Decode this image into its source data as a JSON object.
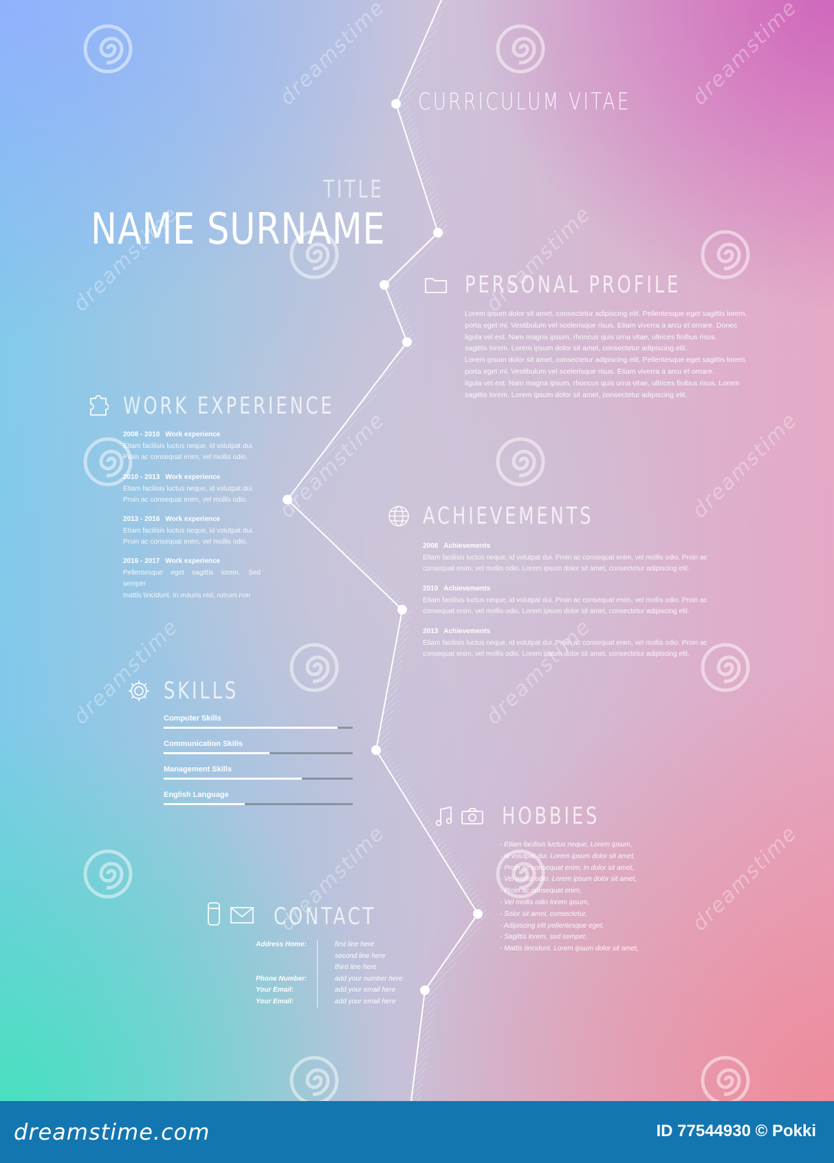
{
  "document": {
    "header": {
      "label": "CURRICULUM VITAE"
    },
    "person": {
      "title": "TITLE",
      "name": "NAME SURNAME"
    },
    "profile": {
      "heading": "PERSONAL PROFILE",
      "icon": "folder-icon",
      "lines": [
        "Lorem ipsum dolor sit amet, consectetur adipiscing elit. Pellentesque eget sagittis lorem.",
        "porta eget mi. Vestibulum vel scelerisque risus. Etiam viverra a arcu et ornare. Donec",
        "ligula vel est. Nam magna ipsum, rhoncus quis urna vitae, ultrices finibus risus.",
        "sagittis lorem. Lorem ipsum dolor sit amet, consectetur adipiscing elit.",
        "Lorem ipsum dolor sit amet, consectetur adipiscing elit. Pellentesque eget sagittis lorem.",
        "porta eget mi. Vestibulum vel scelerisque risus. Etiam viverra a arcu et ornare.",
        "ligula vel est. Nam magna ipsum, rhoncus quis urna vitae, ultrices finibus risus. Lorem",
        "sagittis lorem. Lorem ipsum dolor sit amet, consectetur adipiscing elit."
      ]
    },
    "work": {
      "heading": "WORK EXPERIENCE",
      "icon": "puzzle-icon",
      "entries": [
        {
          "years": "2008 - 2010",
          "label": "Work experience",
          "lines": [
            "Etiam facilisis luctus neque, id volutpat dui.",
            "Proin ac consequat enim, vel mollis odio."
          ]
        },
        {
          "years": "2010 - 2013",
          "label": "Work experience",
          "lines": [
            "Etiam facilisis luctus neque, id volutpat dui.",
            "Proin ac consequat enim, vel mollis odio."
          ]
        },
        {
          "years": "2013 - 2016",
          "label": "Work experience",
          "lines": [
            "Etiam facilisis luctus neque, id volutpat dui.",
            "Proin ac consequat enim, vel mollis odio."
          ]
        },
        {
          "years": "2016 - 2017",
          "label": "Work experience",
          "lines": [
            "Pellentesque eget sagittis lorem. Sed semper",
            "mattis tincidunt. In mauris nisl, rutrum non"
          ]
        }
      ]
    },
    "achievements": {
      "heading": "ACHIEVEMENTS",
      "icon": "globe-icon",
      "entries": [
        {
          "year": "2008",
          "label": "Achievements",
          "lines": [
            "Etiam facilisis luctus neque, id volutpat dui. Proin ac consequat enim, vel mollis odio. Proin ac",
            "consequat enim, vel mollis odio.  Lorem ipsum dolor sit amet, consectetur adipiscing elit."
          ]
        },
        {
          "year": "2010",
          "label": "Achievements",
          "lines": [
            "Etiam facilisis luctus neque, id volutpat dui. Proin ac consequat enim, vel mollis odio. Proin ac",
            "consequat enim, vel mollis odio.  Lorem ipsum dolor sit amet, consectetur adipiscing elit."
          ]
        },
        {
          "year": "2013",
          "label": "Achievements",
          "lines": [
            "Etiam facilisis luctus neque, id volutpat dui. Proin ac consequat enim, vel mollis odio. Proin ac",
            "consequat enim, vel mollis odio.  Lorem ipsum dolor sit amet, consectetur adipiscing elit."
          ]
        }
      ]
    },
    "skills": {
      "heading": "SKILLS",
      "icon": "gear-icon",
      "items": [
        {
          "label": "Computer Skills",
          "level": 0.92
        },
        {
          "label": "Communication Skills",
          "level": 0.56
        },
        {
          "label": "Management Skills",
          "level": 0.73
        },
        {
          "label": "English Language",
          "level": 0.43
        }
      ]
    },
    "hobbies": {
      "heading": "HOBBIES",
      "icons": [
        "music-note-icon",
        "camera-icon"
      ],
      "lines": [
        "- Etiam facilisis luctus neque, Lorem ipsum,",
        "- id volutpat dui.  Lorem ipsum dolor sit amet,",
        "- Proin ac consequat enim,  in dolor sit amet,",
        "- Vel mollis odio. Lorem ipsum dolor sit amet,",
        "- Proin ac consequat enim,",
        "- Vel mollis odio lorem ipsum,",
        "- Solor sit amet, consectetur,",
        "- Adipiscing elit pellentesque eget,",
        "- Sagittis lorem, sed semper,",
        "- Mattis tincidunt. Lorem ipsum dolor sit amet,"
      ]
    },
    "contact": {
      "heading": "CONTACT",
      "icons": [
        "phone-icon",
        "envelope-icon"
      ],
      "keys": [
        "Address Home:",
        "",
        "",
        "Phone Number:",
        "Your Email:",
        "Your Email:"
      ],
      "values": [
        "first line here",
        "second line here",
        "third line here",
        "add your number here",
        "add your email here",
        "add your email here"
      ]
    }
  },
  "watermark": {
    "text": "dreamstime"
  },
  "footer": {
    "brand": "dreamstime.com",
    "image_id": "ID 77544930 © Pokki",
    "background": "#1476b1"
  },
  "colors": {
    "text": "#ffffff",
    "top_left": "#8aaaff",
    "bottom_left": "#46e1be",
    "top_right": "#cd5fb9",
    "bottom_right": "#ee8c9b"
  }
}
